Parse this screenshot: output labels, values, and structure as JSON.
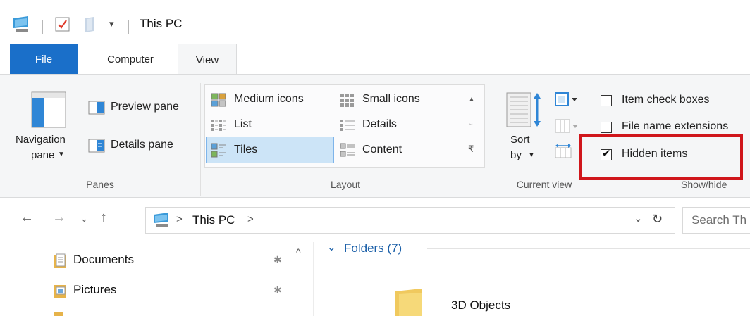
{
  "window": {
    "title": "This PC"
  },
  "ribbon_tabs": {
    "file": "File",
    "computer": "Computer",
    "view": "View"
  },
  "panes": {
    "label": "Panes",
    "navigation_pane": "Navigation",
    "navigation_pane_line2": "pane",
    "preview_pane": "Preview pane",
    "details_pane": "Details pane"
  },
  "layout": {
    "label": "Layout",
    "options": [
      "Medium icons",
      "Small icons",
      "List",
      "Details",
      "Tiles",
      "Content"
    ],
    "selected": "Tiles"
  },
  "current_view": {
    "label": "Current view",
    "sort_by": "Sort",
    "sort_by_line2": "by"
  },
  "show_hide": {
    "label": "Show/hide",
    "item_check_boxes": {
      "label": "Item check boxes",
      "checked": false
    },
    "file_name_extensions": {
      "label": "File name extensions",
      "checked": false
    },
    "hidden_items": {
      "label": "Hidden items",
      "checked": true
    },
    "highlight_color": "#d0161b"
  },
  "address_bar": {
    "path": "This PC",
    "separator": ">",
    "search_placeholder": "Search Th"
  },
  "nav_pane": {
    "items": [
      "Documents",
      "Pictures"
    ]
  },
  "main": {
    "section_header": "Folders (7)",
    "first_folder": "3D Objects"
  },
  "colors": {
    "accent": "#1a6fc9",
    "selection": "#cce4f7"
  }
}
